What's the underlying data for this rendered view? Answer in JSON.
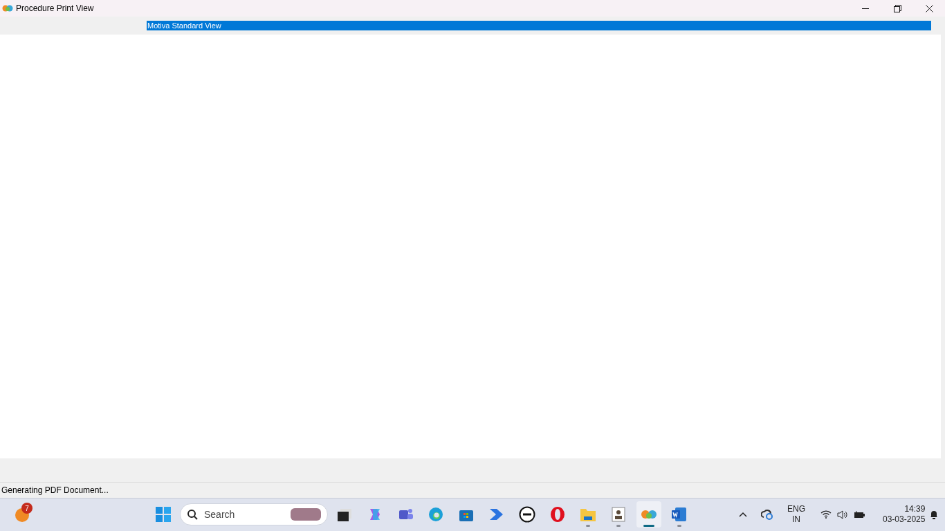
{
  "window": {
    "title": "Procedure Print View"
  },
  "view_list": {
    "items": [
      {
        "label": "Motiva Standard View",
        "selected": true
      }
    ]
  },
  "status_bar": {
    "text": "Generating PDF Document..."
  },
  "taskbar": {
    "widget_badge": "7",
    "search": {
      "placeholder": "Search"
    },
    "apps": [
      {
        "kind": "start",
        "running": false,
        "active": false
      },
      {
        "kind": "taskview",
        "running": false,
        "active": false
      },
      {
        "kind": "copilot",
        "running": false,
        "active": false
      },
      {
        "kind": "teams",
        "running": false,
        "active": false
      },
      {
        "kind": "edge",
        "running": false,
        "active": false
      },
      {
        "kind": "store",
        "running": false,
        "active": false
      },
      {
        "kind": "automate",
        "running": false,
        "active": false
      },
      {
        "kind": "dell",
        "running": false,
        "active": false
      },
      {
        "kind": "opera",
        "running": false,
        "active": false
      },
      {
        "kind": "folder",
        "running": true,
        "active": false
      },
      {
        "kind": "contact",
        "running": true,
        "active": false
      },
      {
        "kind": "motiva",
        "running": true,
        "active": true
      },
      {
        "kind": "word",
        "running": true,
        "active": false
      }
    ],
    "language": {
      "line1": "ENG",
      "line2": "IN"
    },
    "time": "14:39",
    "date": "03-03-2025"
  }
}
